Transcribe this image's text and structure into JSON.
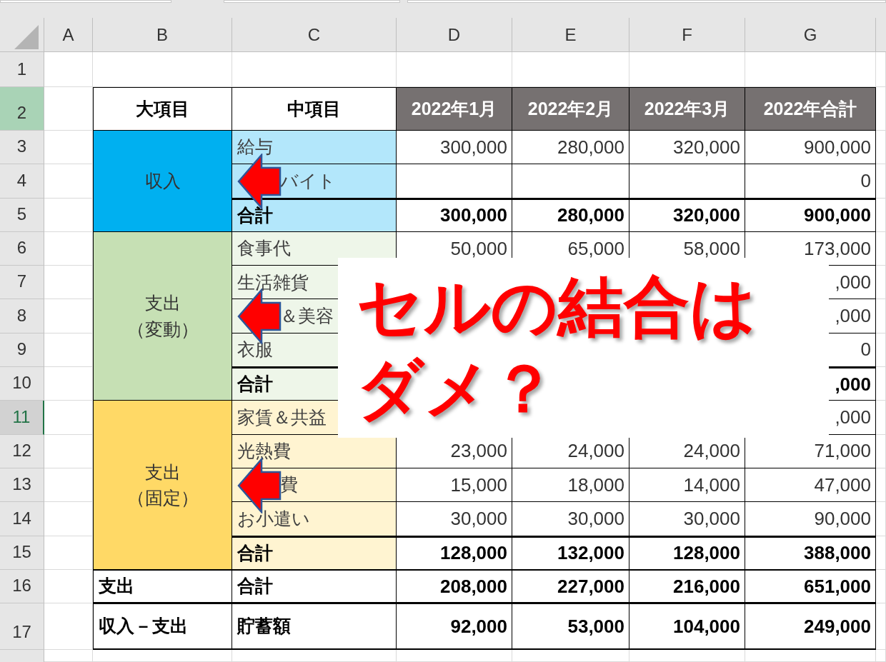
{
  "column_headers": [
    "A",
    "B",
    "C",
    "D",
    "E",
    "F",
    "G"
  ],
  "row_headers": [
    {
      "label": "1",
      "selected": false,
      "focused": false
    },
    {
      "label": "2",
      "selected": true,
      "focused": false
    },
    {
      "label": "3",
      "selected": false,
      "focused": false
    },
    {
      "label": "4",
      "selected": false,
      "focused": false
    },
    {
      "label": "5",
      "selected": false,
      "focused": false
    },
    {
      "label": "6",
      "selected": false,
      "focused": false
    },
    {
      "label": "7",
      "selected": false,
      "focused": false
    },
    {
      "label": "8",
      "selected": false,
      "focused": false
    },
    {
      "label": "9",
      "selected": false,
      "focused": false
    },
    {
      "label": "10",
      "selected": false,
      "focused": false
    },
    {
      "label": "11",
      "selected": false,
      "focused": true
    },
    {
      "label": "12",
      "selected": false,
      "focused": false
    },
    {
      "label": "13",
      "selected": false,
      "focused": false
    },
    {
      "label": "14",
      "selected": false,
      "focused": false
    },
    {
      "label": "15",
      "selected": false,
      "focused": false
    },
    {
      "label": "16",
      "selected": false,
      "focused": false
    },
    {
      "label": "17",
      "selected": false,
      "focused": false
    }
  ],
  "table": {
    "headers": [
      "大項目",
      "中項目",
      "2022年1月",
      "2022年2月",
      "2022年3月",
      "2022年合計"
    ],
    "groups": [
      {
        "label_lines": [
          "収入"
        ],
        "color": "#00b0f0",
        "items": [
          {
            "name": "給与",
            "values": {
              "D": "300,000",
              "E": "280,000",
              "F": "320,000",
              "G": "900,000"
            },
            "total": false,
            "arrow": false
          },
          {
            "name": "バイト",
            "values": {
              "G": "0"
            },
            "total": false,
            "arrow": true
          },
          {
            "name": "合計",
            "values": {
              "D": "300,000",
              "E": "280,000",
              "F": "320,000",
              "G": "900,000"
            },
            "total": true,
            "arrow": false
          }
        ]
      },
      {
        "label_lines": [
          "支出",
          "（変動）"
        ],
        "color": "#c6e0b4",
        "items": [
          {
            "name": "食事代",
            "values": {
              "D": "50,000",
              "E": "65,000",
              "F": "58,000",
              "G": "173,000"
            },
            "total": false,
            "arrow": false
          },
          {
            "name": "生活雑貨",
            "values": {
              "G": ",000"
            },
            "total": false,
            "arrow": false
          },
          {
            "name": "＆美容",
            "values": {
              "G": ",000"
            },
            "total": false,
            "arrow": true
          },
          {
            "name": "衣服",
            "values": {
              "G": "0"
            },
            "total": false,
            "arrow": false
          },
          {
            "name": "合計",
            "values": {
              "G": ",000"
            },
            "total": true,
            "arrow": false
          }
        ]
      },
      {
        "label_lines": [
          "支出",
          "（固定）"
        ],
        "color": "#ffd966",
        "items": [
          {
            "name": "家賃＆共益",
            "values": {
              "G": ",000"
            },
            "total": false,
            "arrow": false
          },
          {
            "name": "光熱費",
            "values": {
              "D": "23,000",
              "E": "24,000",
              "F": "24,000",
              "G": "71,000"
            },
            "total": false,
            "arrow": false
          },
          {
            "name": "費",
            "values": {
              "D": "15,000",
              "E": "18,000",
              "F": "14,000",
              "G": "47,000"
            },
            "total": false,
            "arrow": true
          },
          {
            "name": "お小遣い",
            "values": {
              "D": "30,000",
              "E": "30,000",
              "F": "30,000",
              "G": "90,000"
            },
            "total": false,
            "arrow": false
          },
          {
            "name": "合計",
            "values": {
              "D": "128,000",
              "E": "132,000",
              "F": "128,000",
              "G": "388,000"
            },
            "total": true,
            "arrow": false
          }
        ]
      }
    ],
    "summary_rows": [
      {
        "category": "支出",
        "item": "合計",
        "values": {
          "D": "208,000",
          "E": "227,000",
          "F": "216,000",
          "G": "651,000"
        }
      },
      {
        "category": "収入－支出",
        "item": "貯蓄額",
        "values": {
          "D": "92,000",
          "E": "53,000",
          "F": "104,000",
          "G": "249,000"
        }
      }
    ]
  },
  "overlay": {
    "lines": [
      "セルの結合は",
      "ダメ？"
    ]
  }
}
